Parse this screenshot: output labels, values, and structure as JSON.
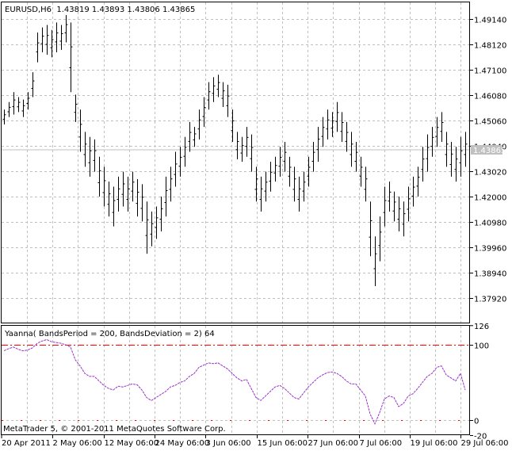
{
  "window": {
    "symbol_info": "EURUSD,H6  1.43819 1.43893 1.43806 1.43865",
    "copyright": "MetaTrader 5, © 2001-2011 MetaQuotes Software Corp."
  },
  "chart_data": [
    {
      "type": "bar",
      "symbol": "EURUSD",
      "timeframe": "H6",
      "ohlc_last": {
        "open": 1.43819,
        "high": 1.43893,
        "low": 1.43806,
        "close": 1.43865
      },
      "current_price": "1.43865",
      "y_ticks": [
        "1.49140",
        "1.48120",
        "1.47100",
        "1.46080",
        "1.45060",
        "1.44040",
        "1.43020",
        "1.42000",
        "1.40980",
        "1.39960",
        "1.38940",
        "1.37920"
      ],
      "x_ticks": [
        "20 Apr 2011",
        "2 May 06:00",
        "12 May 06:00",
        "24 May 06:00",
        "3 Jun 06:00",
        "15 Jun 06:00",
        "27 Jun 06:00",
        "7 Jul 06:00",
        "19 Jul 06:00",
        "29 Jul 06:00"
      ],
      "grid": true,
      "bars_high_low": [
        [
          1.455,
          1.449
        ],
        [
          1.458,
          1.452
        ],
        [
          1.462,
          1.453
        ],
        [
          1.46,
          1.454
        ],
        [
          1.459,
          1.452
        ],
        [
          1.462,
          1.455
        ],
        [
          1.47,
          1.46
        ],
        [
          1.486,
          1.474
        ],
        [
          1.488,
          1.478
        ],
        [
          1.489,
          1.477
        ],
        [
          1.487,
          1.476
        ],
        [
          1.49,
          1.478
        ],
        [
          1.489,
          1.479
        ],
        [
          1.493,
          1.482
        ],
        [
          1.49,
          1.462
        ],
        [
          1.461,
          1.45
        ],
        [
          1.455,
          1.438
        ],
        [
          1.446,
          1.432
        ],
        [
          1.444,
          1.428
        ],
        [
          1.443,
          1.43
        ],
        [
          1.436,
          1.42
        ],
        [
          1.432,
          1.416
        ],
        [
          1.426,
          1.412
        ],
        [
          1.424,
          1.408
        ],
        [
          1.428,
          1.414
        ],
        [
          1.43,
          1.416
        ],
        [
          1.428,
          1.414
        ],
        [
          1.43,
          1.418
        ],
        [
          1.427,
          1.412
        ],
        [
          1.425,
          1.41
        ],
        [
          1.418,
          1.397
        ],
        [
          1.414,
          1.4
        ],
        [
          1.416,
          1.403
        ],
        [
          1.42,
          1.406
        ],
        [
          1.428,
          1.412
        ],
        [
          1.432,
          1.418
        ],
        [
          1.438,
          1.424
        ],
        [
          1.44,
          1.428
        ],
        [
          1.444,
          1.432
        ],
        [
          1.45,
          1.438
        ],
        [
          1.448,
          1.44
        ],
        [
          1.455,
          1.443
        ],
        [
          1.46,
          1.448
        ],
        [
          1.466,
          1.455
        ],
        [
          1.468,
          1.458
        ],
        [
          1.469,
          1.46
        ],
        [
          1.466,
          1.456
        ],
        [
          1.465,
          1.452
        ],
        [
          1.455,
          1.442
        ],
        [
          1.446,
          1.435
        ],
        [
          1.444,
          1.434
        ],
        [
          1.448,
          1.436
        ],
        [
          1.445,
          1.43
        ],
        [
          1.432,
          1.418
        ],
        [
          1.428,
          1.414
        ],
        [
          1.43,
          1.418
        ],
        [
          1.434,
          1.422
        ],
        [
          1.436,
          1.426
        ],
        [
          1.44,
          1.428
        ],
        [
          1.442,
          1.43
        ],
        [
          1.436,
          1.424
        ],
        [
          1.432,
          1.418
        ],
        [
          1.428,
          1.414
        ],
        [
          1.43,
          1.418
        ],
        [
          1.436,
          1.424
        ],
        [
          1.442,
          1.43
        ],
        [
          1.448,
          1.434
        ],
        [
          1.452,
          1.44
        ],
        [
          1.455,
          1.443
        ],
        [
          1.454,
          1.444
        ],
        [
          1.458,
          1.446
        ],
        [
          1.454,
          1.442
        ],
        [
          1.45,
          1.438
        ],
        [
          1.446,
          1.432
        ],
        [
          1.442,
          1.43
        ],
        [
          1.436,
          1.424
        ],
        [
          1.432,
          1.418
        ],
        [
          1.418,
          1.396
        ],
        [
          1.404,
          1.384
        ],
        [
          1.412,
          1.394
        ],
        [
          1.424,
          1.408
        ],
        [
          1.426,
          1.414
        ],
        [
          1.422,
          1.41
        ],
        [
          1.42,
          1.406
        ],
        [
          1.418,
          1.404
        ],
        [
          1.424,
          1.41
        ],
        [
          1.428,
          1.416
        ],
        [
          1.432,
          1.42
        ],
        [
          1.44,
          1.426
        ],
        [
          1.445,
          1.43
        ],
        [
          1.448,
          1.436
        ],
        [
          1.452,
          1.44
        ],
        [
          1.454,
          1.442
        ],
        [
          1.446,
          1.432
        ],
        [
          1.442,
          1.428
        ],
        [
          1.44,
          1.426
        ],
        [
          1.444,
          1.428
        ],
        [
          1.446,
          1.432
        ]
      ],
      "ylim": [
        1.3741,
        1.4982
      ],
      "colors": {
        "bars": "#000000",
        "grid": "#c0c0c0",
        "price_line": "#c0c0c0",
        "price_label_bg": "#c0c0c0"
      }
    },
    {
      "type": "line",
      "label": "Yaanna( BandsPeriod = 200, BandsDeviation = 2) 64",
      "y_ticks": [
        "126",
        "100",
        "0",
        "-20"
      ],
      "levels": [
        100,
        0
      ],
      "ylim": [
        -20,
        126
      ],
      "values": [
        92,
        95,
        97,
        94,
        92,
        93,
        96,
        102,
        105,
        107,
        104,
        103,
        102,
        100,
        97,
        80,
        72,
        62,
        58,
        58,
        52,
        46,
        42,
        40,
        45,
        44,
        46,
        48,
        47,
        40,
        30,
        26,
        30,
        34,
        38,
        44,
        46,
        50,
        52,
        58,
        62,
        70,
        73,
        76,
        75,
        76,
        72,
        68,
        62,
        56,
        52,
        54,
        42,
        30,
        26,
        32,
        38,
        44,
        46,
        42,
        36,
        30,
        28,
        36,
        44,
        50,
        56,
        60,
        63,
        64,
        62,
        58,
        52,
        48,
        48,
        40,
        32,
        8,
        -5,
        10,
        28,
        32,
        30,
        18,
        22,
        32,
        35,
        42,
        50,
        58,
        62,
        70,
        72,
        60,
        56,
        52,
        62,
        40
      ],
      "colors": {
        "line": "#9932cc",
        "levels": "#ff0000"
      }
    }
  ]
}
